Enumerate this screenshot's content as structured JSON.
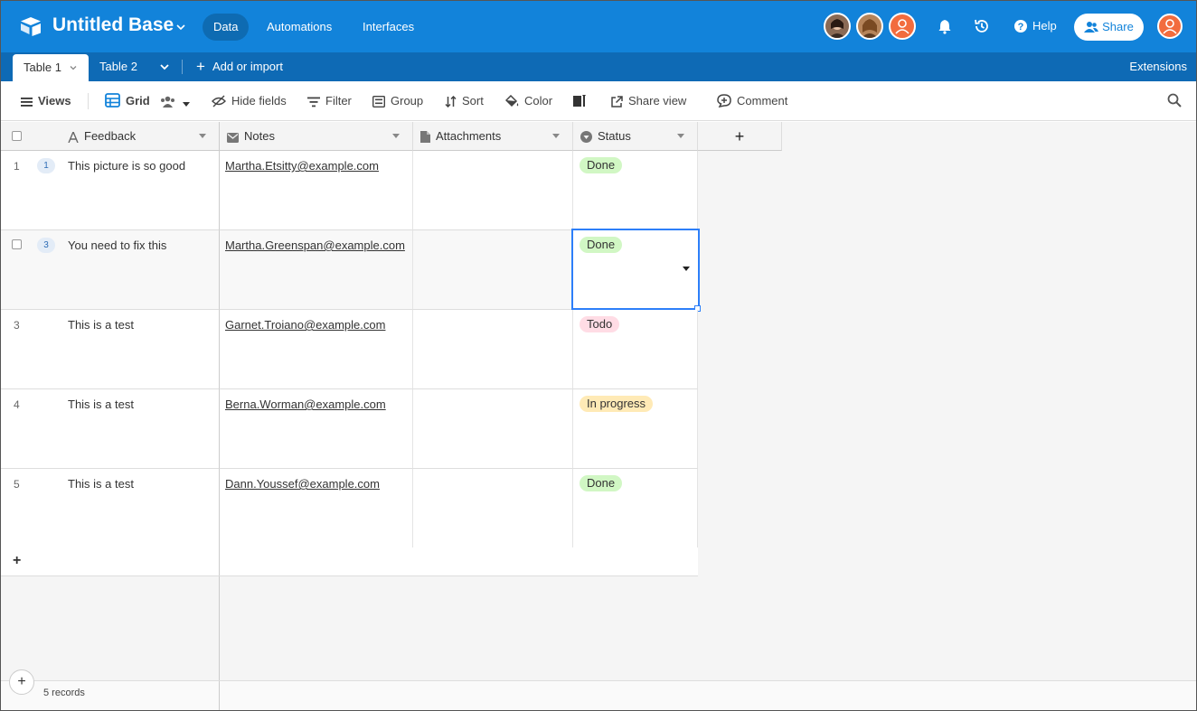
{
  "app": {
    "base_title": "Untitled Base",
    "nav": [
      "Data",
      "Automations",
      "Interfaces"
    ],
    "help_label": "Help",
    "share_label": "Share"
  },
  "tabs": {
    "table1": "Table 1",
    "table2": "Table 2",
    "add_import": "Add or import",
    "extensions": "Extensions"
  },
  "toolbar": {
    "views": "Views",
    "grid": "Grid",
    "hide_fields": "Hide fields",
    "filter": "Filter",
    "group": "Group",
    "sort": "Sort",
    "color": "Color",
    "share_view": "Share view",
    "comment": "Comment"
  },
  "columns": [
    "Feedback",
    "Notes",
    "Attachments",
    "Status"
  ],
  "rows": [
    {
      "num": "1",
      "comments": "1",
      "feedback": "This picture is so good",
      "notes": "Martha.Etsitty@example.com",
      "status": "Done"
    },
    {
      "num": "",
      "comments": "3",
      "feedback": "You need to fix this",
      "notes": "Martha.Greenspan@example.com",
      "status": "Done"
    },
    {
      "num": "3",
      "comments": "",
      "feedback": "This is a test",
      "notes": "Garnet.Troiano@example.com",
      "status": "Todo"
    },
    {
      "num": "4",
      "comments": "",
      "feedback": "This is a test",
      "notes": "Berna.Worman@example.com",
      "status": "In progress"
    },
    {
      "num": "5",
      "comments": "",
      "feedback": "This is a test",
      "notes": "Dann.Youssef@example.com",
      "status": "Done"
    }
  ],
  "status_colors": {
    "Done": "#d1f7c4",
    "Todo": "#ffdce5",
    "In progress": "#ffeab6"
  },
  "colors": {
    "brand": "#1283da",
    "tab_bar": "#0e6ab5",
    "selection": "#2d7ff9"
  },
  "footer": {
    "records": "5 records"
  }
}
